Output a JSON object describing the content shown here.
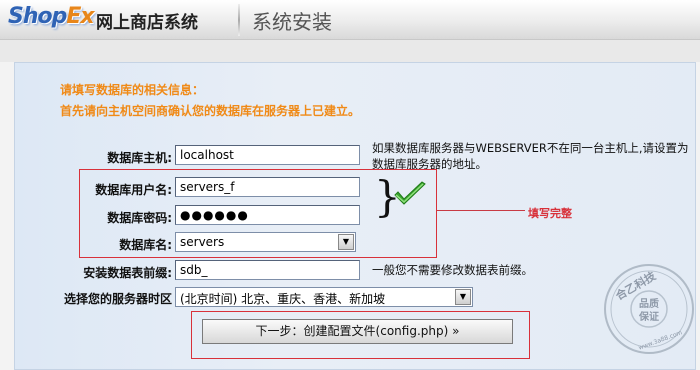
{
  "header": {
    "logo_text": "ShopEx",
    "logo_part1": "Shop",
    "logo_part2": "Ex",
    "app_name": "网上商店系统",
    "page_title": "系统安装"
  },
  "intro": {
    "line1": "请填写数据库的相关信息：",
    "line2": "首先请向主机空间商确认您的数据库在服务器上已建立。"
  },
  "form": {
    "host": {
      "label": "数据库主机:",
      "value": "localhost",
      "hint": "如果数据库服务器与WEBSERVER不在同一台主机上,请设置为数据库服务器的地址。"
    },
    "username": {
      "label": "数据库用户名:",
      "value": "servers_f"
    },
    "password": {
      "label": "数据库密码:",
      "value": "●●●●●●"
    },
    "dbname": {
      "label": "数据库名:",
      "value": "servers"
    },
    "prefix": {
      "label": "安装数据表前缀:",
      "value": "sdb_",
      "hint": "一般您不需要修改数据表前缀。"
    },
    "timezone": {
      "label": "选择您的服务器时区",
      "value": "(北京时间) 北京、重庆、香港、新加坡"
    }
  },
  "annotation": {
    "brace": "}",
    "text": "填写完整"
  },
  "next_button": {
    "label": "下一步：创建配置文件(config.php) »"
  },
  "watermark": {
    "line1": "合乙科技",
    "line2": "品质",
    "line3": "保证",
    "url": "www.3a88.com"
  },
  "colors": {
    "intro_text": "#f08a17",
    "annotation_red": "#d8313a",
    "check_green": "#3aa52e",
    "logo_blue": "#2f63b5",
    "logo_orange": "#e8861a"
  }
}
